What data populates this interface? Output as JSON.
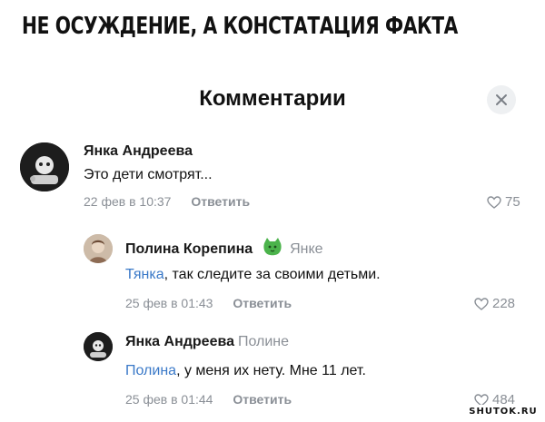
{
  "headline": "НЕ ОСУЖДЕНИЕ, А КОНСТАТАЦИЯ ФАКТА",
  "panel": {
    "title": "Комментарии"
  },
  "comments": [
    {
      "author": "Янка Андреева",
      "reply_to": "",
      "mention": "",
      "text": "Это дети смотрят...",
      "date": "22 фев в 10:37",
      "reply_label": "Ответить",
      "likes": "75"
    },
    {
      "author": "Полина Корепина",
      "reply_to": "Янке",
      "mention": "Тянка",
      "text": ", так следите за своими детьми.",
      "date": "25 фев в 01:43",
      "reply_label": "Ответить",
      "likes": "228"
    },
    {
      "author": "Янка Андреева",
      "reply_to": "Полине",
      "mention": "Полина",
      "text": ", у меня их нету. Мне 11 лет.",
      "date": "25 фев в 01:44",
      "reply_label": "Ответить",
      "likes": "484"
    }
  ],
  "watermark": "SHUTOK.RU",
  "colors": {
    "mention": "#3a79c8",
    "meta": "#8a8f96",
    "close_bg": "#eef0f2",
    "badge": "#4bb34b"
  },
  "icons": {
    "close": "close-icon",
    "like": "heart-outline-icon",
    "badge": "cat-emoji-badge-icon"
  }
}
